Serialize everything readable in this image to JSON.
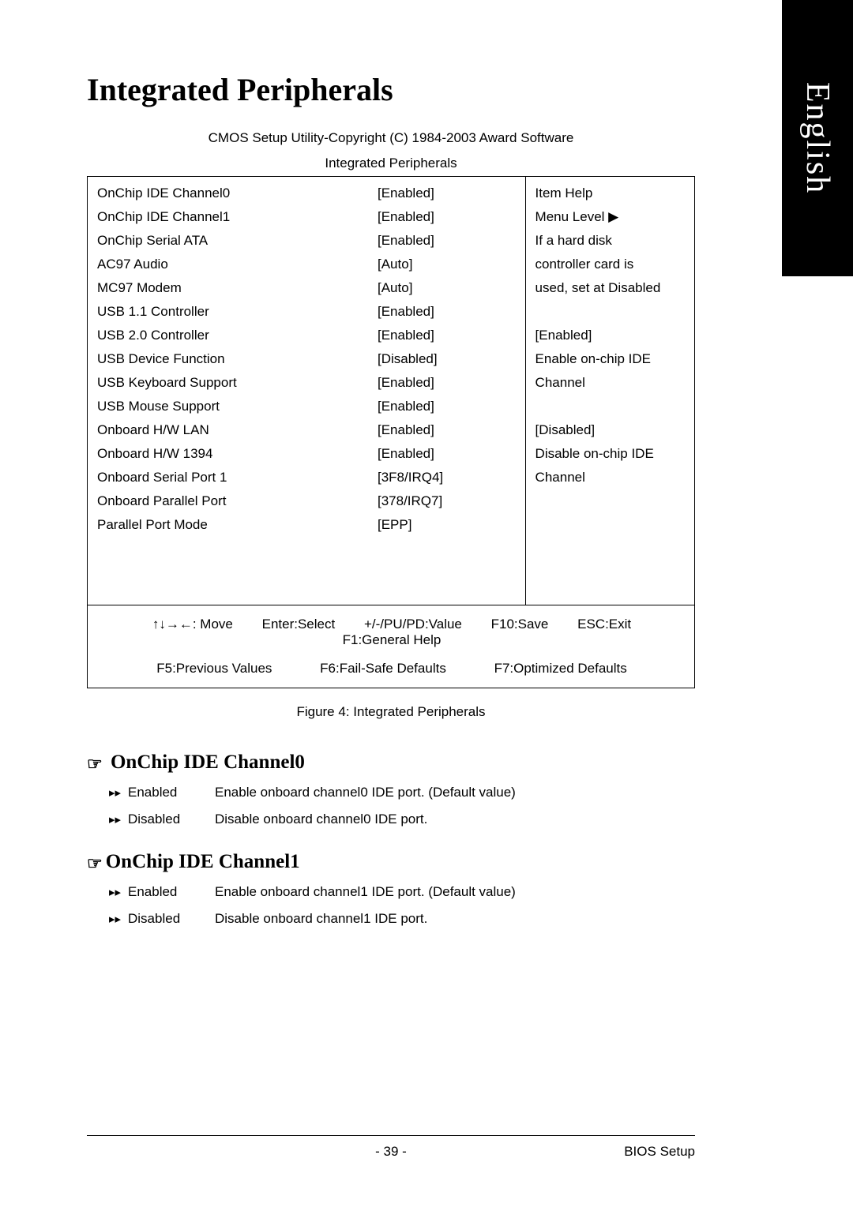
{
  "side_tab": "English",
  "title": "Integrated   Peripherals",
  "cmos_header": "CMOS Setup Utility-Copyright (C) 1984-2003 Award Software",
  "cmos_subheader": "Integrated Peripherals",
  "settings": [
    {
      "label": "OnChip IDE Channel0",
      "value": "[Enabled]"
    },
    {
      "label": "OnChip IDE Channel1",
      "value": "[Enabled]"
    },
    {
      "label": "OnChip Serial ATA",
      "value": "[Enabled]"
    },
    {
      "label": "AC97 Audio",
      "value": "[Auto]"
    },
    {
      "label": "MC97 Modem",
      "value": "[Auto]"
    },
    {
      "label": "USB 1.1 Controller",
      "value": "[Enabled]"
    },
    {
      "label": "USB 2.0 Controller",
      "value": "[Enabled]"
    },
    {
      "label": "USB Device Function",
      "value": "[Disabled]"
    },
    {
      "label": "USB Keyboard Support",
      "value": "[Enabled]"
    },
    {
      "label": "USB Mouse Support",
      "value": "[Enabled]"
    },
    {
      "label": "Onboard H/W LAN",
      "value": "[Enabled]"
    },
    {
      "label": "Onboard H/W 1394",
      "value": "[Enabled]"
    },
    {
      "label": "Onboard Serial Port 1",
      "value": "[3F8/IRQ4]"
    },
    {
      "label": "Onboard Parallel Port",
      "value": "[378/IRQ7]"
    },
    {
      "label": "Parallel Port Mode",
      "value": "[EPP]"
    }
  ],
  "help_lines": [
    "Item Help",
    "Menu Level ▶",
    "If a hard disk",
    "controller card is",
    "used, set at Disabled",
    "",
    "[Enabled]",
    "Enable on-chip IDE",
    "Channel",
    "",
    "[Disabled]",
    "Disable on-chip IDE",
    "Channel"
  ],
  "keys": {
    "move": "↑↓→←: Move",
    "select": "Enter:Select",
    "value": "+/-/PU/PD:Value",
    "save": "F10:Save",
    "exit": "ESC:Exit",
    "help": "F1:General Help",
    "prev": "F5:Previous Values",
    "failsafe": "F6:Fail-Safe Defaults",
    "optimized": "F7:Optimized Defaults"
  },
  "caption": "Figure 4: Integrated Peripherals",
  "sections": [
    {
      "title": "OnChip IDE Channel0",
      "options": [
        {
          "label": "Enabled",
          "desc": "Enable onboard channel0 IDE port. (Default value)"
        },
        {
          "label": "Disabled",
          "desc": "Disable onboard channel0 IDE port."
        }
      ]
    },
    {
      "title": "OnChip IDE Channel1",
      "options": [
        {
          "label": "Enabled",
          "desc": "Enable onboard channel1 IDE port. (Default value)"
        },
        {
          "label": "Disabled",
          "desc": "Disable onboard channel1 IDE port."
        }
      ]
    }
  ],
  "footer": {
    "page": "- 39 -",
    "section": "BIOS Setup"
  }
}
